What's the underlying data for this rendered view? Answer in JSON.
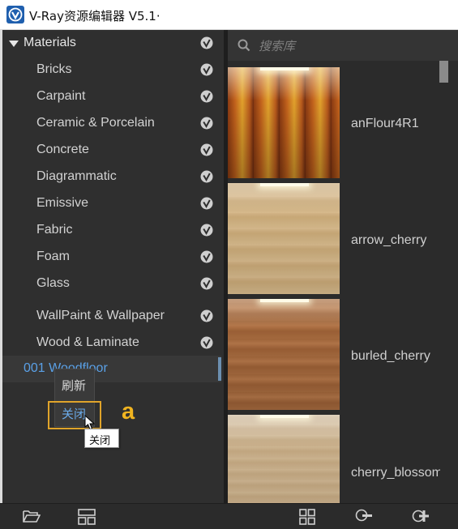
{
  "window": {
    "title": "V-Ray资源编辑器 V5.1·"
  },
  "tree": {
    "root_label": "Materials",
    "items": [
      {
        "label": "Bricks"
      },
      {
        "label": "Carpaint"
      },
      {
        "label": "Ceramic & Porcelain"
      },
      {
        "label": "Concrete"
      },
      {
        "label": "Diagrammatic"
      },
      {
        "label": "Emissive"
      },
      {
        "label": "Fabric"
      },
      {
        "label": "Foam"
      },
      {
        "label": "Glass"
      },
      {
        "label": "WallPaint & Wallpaper"
      },
      {
        "label": "Wood & Laminate"
      }
    ],
    "selected_label": "001 Woodfloor"
  },
  "context_menu": {
    "refresh": "刷新",
    "close": "关闭"
  },
  "tooltip": "关闭",
  "annotation": "a",
  "search": {
    "placeholder": "搜索库"
  },
  "library": {
    "items": [
      {
        "label": "anFlour4R1"
      },
      {
        "label": "arrow_cherry"
      },
      {
        "label": "burled_cherry"
      },
      {
        "label": "cherry_blossom"
      }
    ]
  },
  "colors": {
    "accent": "#5aa0e6",
    "highlight": "#e0a42a",
    "panel": "#2f2f2f"
  }
}
